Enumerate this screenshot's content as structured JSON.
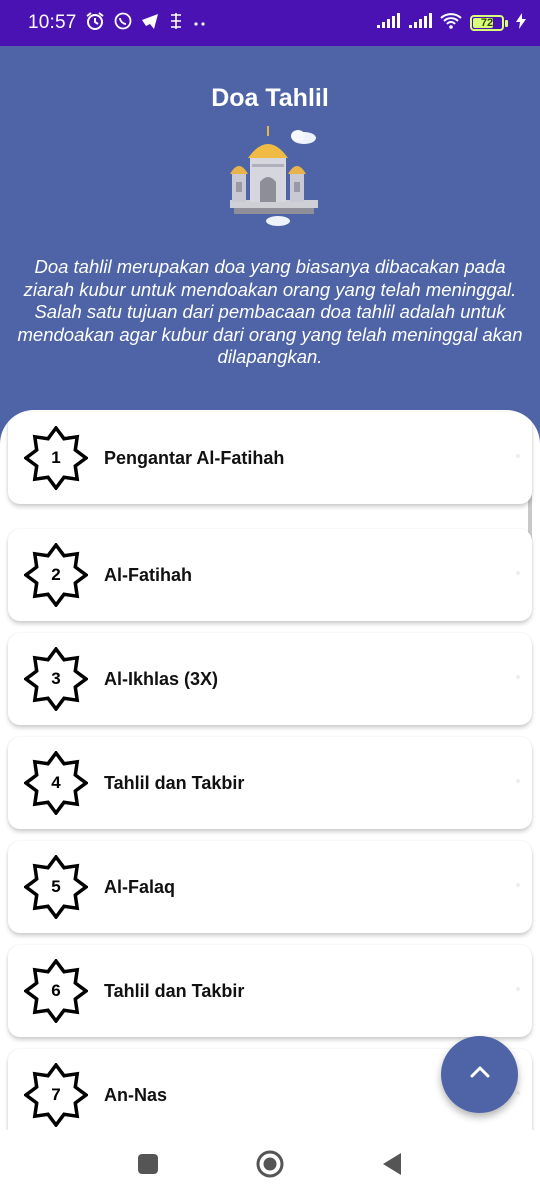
{
  "status_bar": {
    "time": "10:57",
    "battery_level": "72",
    "notification_icons": [
      "alarm-icon",
      "whatsapp-icon",
      "telegram-icon",
      "app-icon",
      "more-icon"
    ],
    "right_icons": [
      "signal-icon",
      "signal-icon",
      "wifi-icon",
      "battery-icon",
      "charging-icon"
    ]
  },
  "header": {
    "title": "Doa Tahlil",
    "description": "Doa tahlil merupakan doa yang biasanya dibacakan pada ziarah kubur untuk mendoakan orang yang telah meninggal. Salah satu tujuan dari pembacaan doa tahlil adalah untuk mendoakan agar kubur dari orang yang telah meninggal akan dilapangkan.",
    "icon": "mosque-icon"
  },
  "list": {
    "items": [
      {
        "number": "1",
        "label": "Pengantar Al-Fatihah"
      },
      {
        "number": "2",
        "label": "Al-Fatihah"
      },
      {
        "number": "3",
        "label": "Al-Ikhlas (3X)"
      },
      {
        "number": "4",
        "label": "Tahlil dan Takbir"
      },
      {
        "number": "5",
        "label": "Al-Falaq"
      },
      {
        "number": "6",
        "label": "Tahlil dan Takbir"
      },
      {
        "number": "7",
        "label": "An-Nas"
      }
    ]
  },
  "fab": {
    "icon": "chevron-up-icon"
  },
  "nav_bar": {
    "icons": [
      "recents-icon",
      "home-icon",
      "back-icon"
    ]
  },
  "colors": {
    "status_bar": "#4a11b3",
    "header": "#4e64a6",
    "fab": "#4e64a6",
    "battery": "#d8ff77"
  }
}
